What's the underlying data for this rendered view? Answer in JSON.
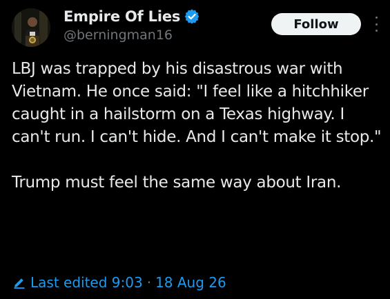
{
  "author": {
    "display_name": "Empire Of Lies",
    "handle": "@berningman16",
    "verified": true
  },
  "actions": {
    "follow_label": "Follow"
  },
  "tweet": {
    "paragraph_1": "LBJ was trapped by his disastrous war with Vietnam. He once said: \"I feel like a hitchhiker caught in a hailstorm on a Texas highway. I can't run. I can't hide. And I can't make it stop.\"",
    "paragraph_2": "Trump must feel the same way about Iran."
  },
  "meta": {
    "edited_label": "Last edited 9:03",
    "separator": "·",
    "date": "18 Aug 26"
  },
  "colors": {
    "background": "#000000",
    "text": "#e7e9ea",
    "muted": "#71767b",
    "accent": "#1d9bf0"
  },
  "icons": {
    "verified": "verified-badge-icon",
    "more": "more-options-icon",
    "edit": "edit-pencil-icon"
  }
}
